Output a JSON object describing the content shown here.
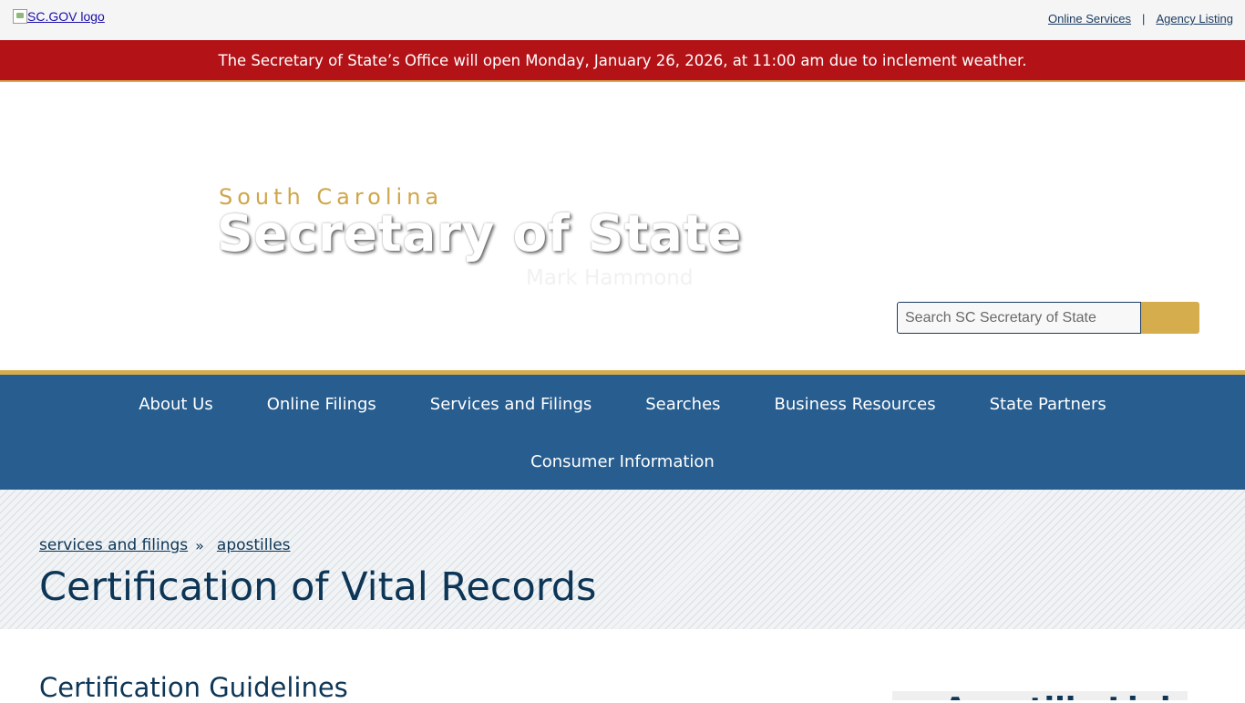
{
  "topbar": {
    "logo_alt": "SC.GOV logo",
    "links": [
      "Online Services",
      "Agency Listing"
    ],
    "separator": "|"
  },
  "alert": {
    "text": "The Secretary of State’s Office will open Monday, January 26, 2026, at 11:00 am due to inclement weather."
  },
  "brand": {
    "state": "South Carolina",
    "title": "Secretary of State",
    "officer": "Mark Hammond"
  },
  "search": {
    "placeholder": "Search SC Secretary of State"
  },
  "nav": {
    "items": [
      "About Us",
      "Online Filings",
      "Services and Filings",
      "Searches",
      "Business Resources",
      "State Partners",
      "Consumer Information"
    ]
  },
  "breadcrumb": {
    "items": [
      "services and filings",
      "apostilles"
    ],
    "separator": "»"
  },
  "page": {
    "title": "Certification of Vital Records",
    "section_title": "Certification Guidelines",
    "sidebar_title": "Apostille Links"
  },
  "colors": {
    "alert_bg": "#b31217",
    "nav_bg": "#275d8f",
    "gold": "#d6ad4c",
    "heading": "#0c3556"
  }
}
